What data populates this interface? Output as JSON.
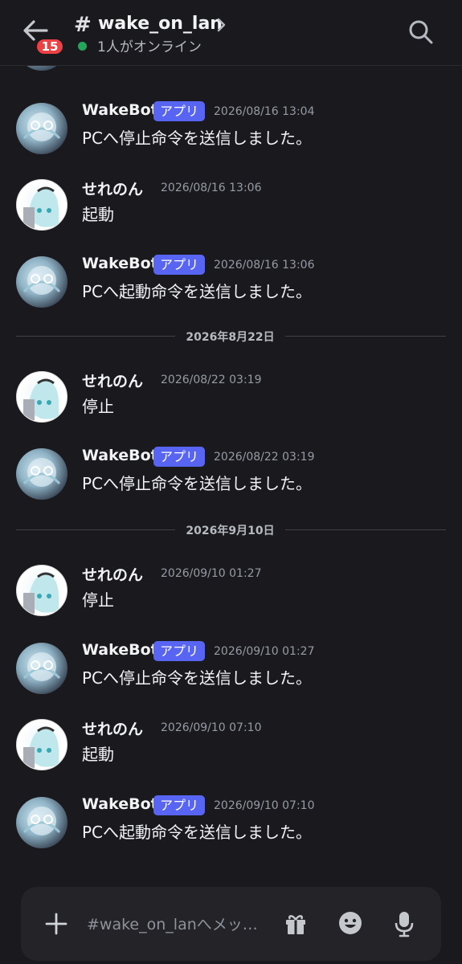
{
  "header": {
    "back_label": "戻る",
    "unread_count": "15",
    "channel_hash": "#",
    "channel_name": "wake_on_lan",
    "online_text": "1人がオンライン"
  },
  "icons": {
    "back": "arrow-left-icon",
    "search": "search-icon",
    "plus": "plus-icon",
    "gift": "gift-icon",
    "emoji": "emoji-icon",
    "mic": "mic-icon"
  },
  "colors": {
    "background": "#1a1a1e",
    "accent": "#5865f2",
    "badge": "#ed4245",
    "online": "#23a55a"
  },
  "messages": [
    {
      "author": "WakeBot",
      "tag": "アプリ",
      "time": "2026/08/16 13:04",
      "text": "PCへ停止命令を送信しました。"
    },
    {
      "author": "せれのん",
      "time": "2026/08/16 13:06",
      "text": "起動"
    },
    {
      "author": "WakeBot",
      "tag": "アプリ",
      "time": "2026/08/16 13:06",
      "text": "PCへ起動命令を送信しました。"
    },
    {
      "divider": "2026年8月22日"
    },
    {
      "author": "せれのん",
      "time": "2026/08/22 03:19",
      "text": "停止"
    },
    {
      "author": "WakeBot",
      "tag": "アプリ",
      "time": "2026/08/22 03:19",
      "text": "PCへ停止命令を送信しました。"
    },
    {
      "divider": "2026年9月10日"
    },
    {
      "author": "せれのん",
      "time": "2026/09/10 01:27",
      "text": "停止"
    },
    {
      "author": "WakeBot",
      "tag": "アプリ",
      "time": "2026/09/10 01:27",
      "text": "PCへ停止命令を送信しました。"
    },
    {
      "author": "せれのん",
      "time": "2026/09/10 07:10",
      "text": "起動"
    },
    {
      "author": "WakeBot",
      "tag": "アプリ",
      "time": "2026/09/10 07:10",
      "text": "PCへ起動命令を送信しました。"
    }
  ],
  "composer": {
    "placeholder": "#wake_on_lanへメッ…"
  }
}
